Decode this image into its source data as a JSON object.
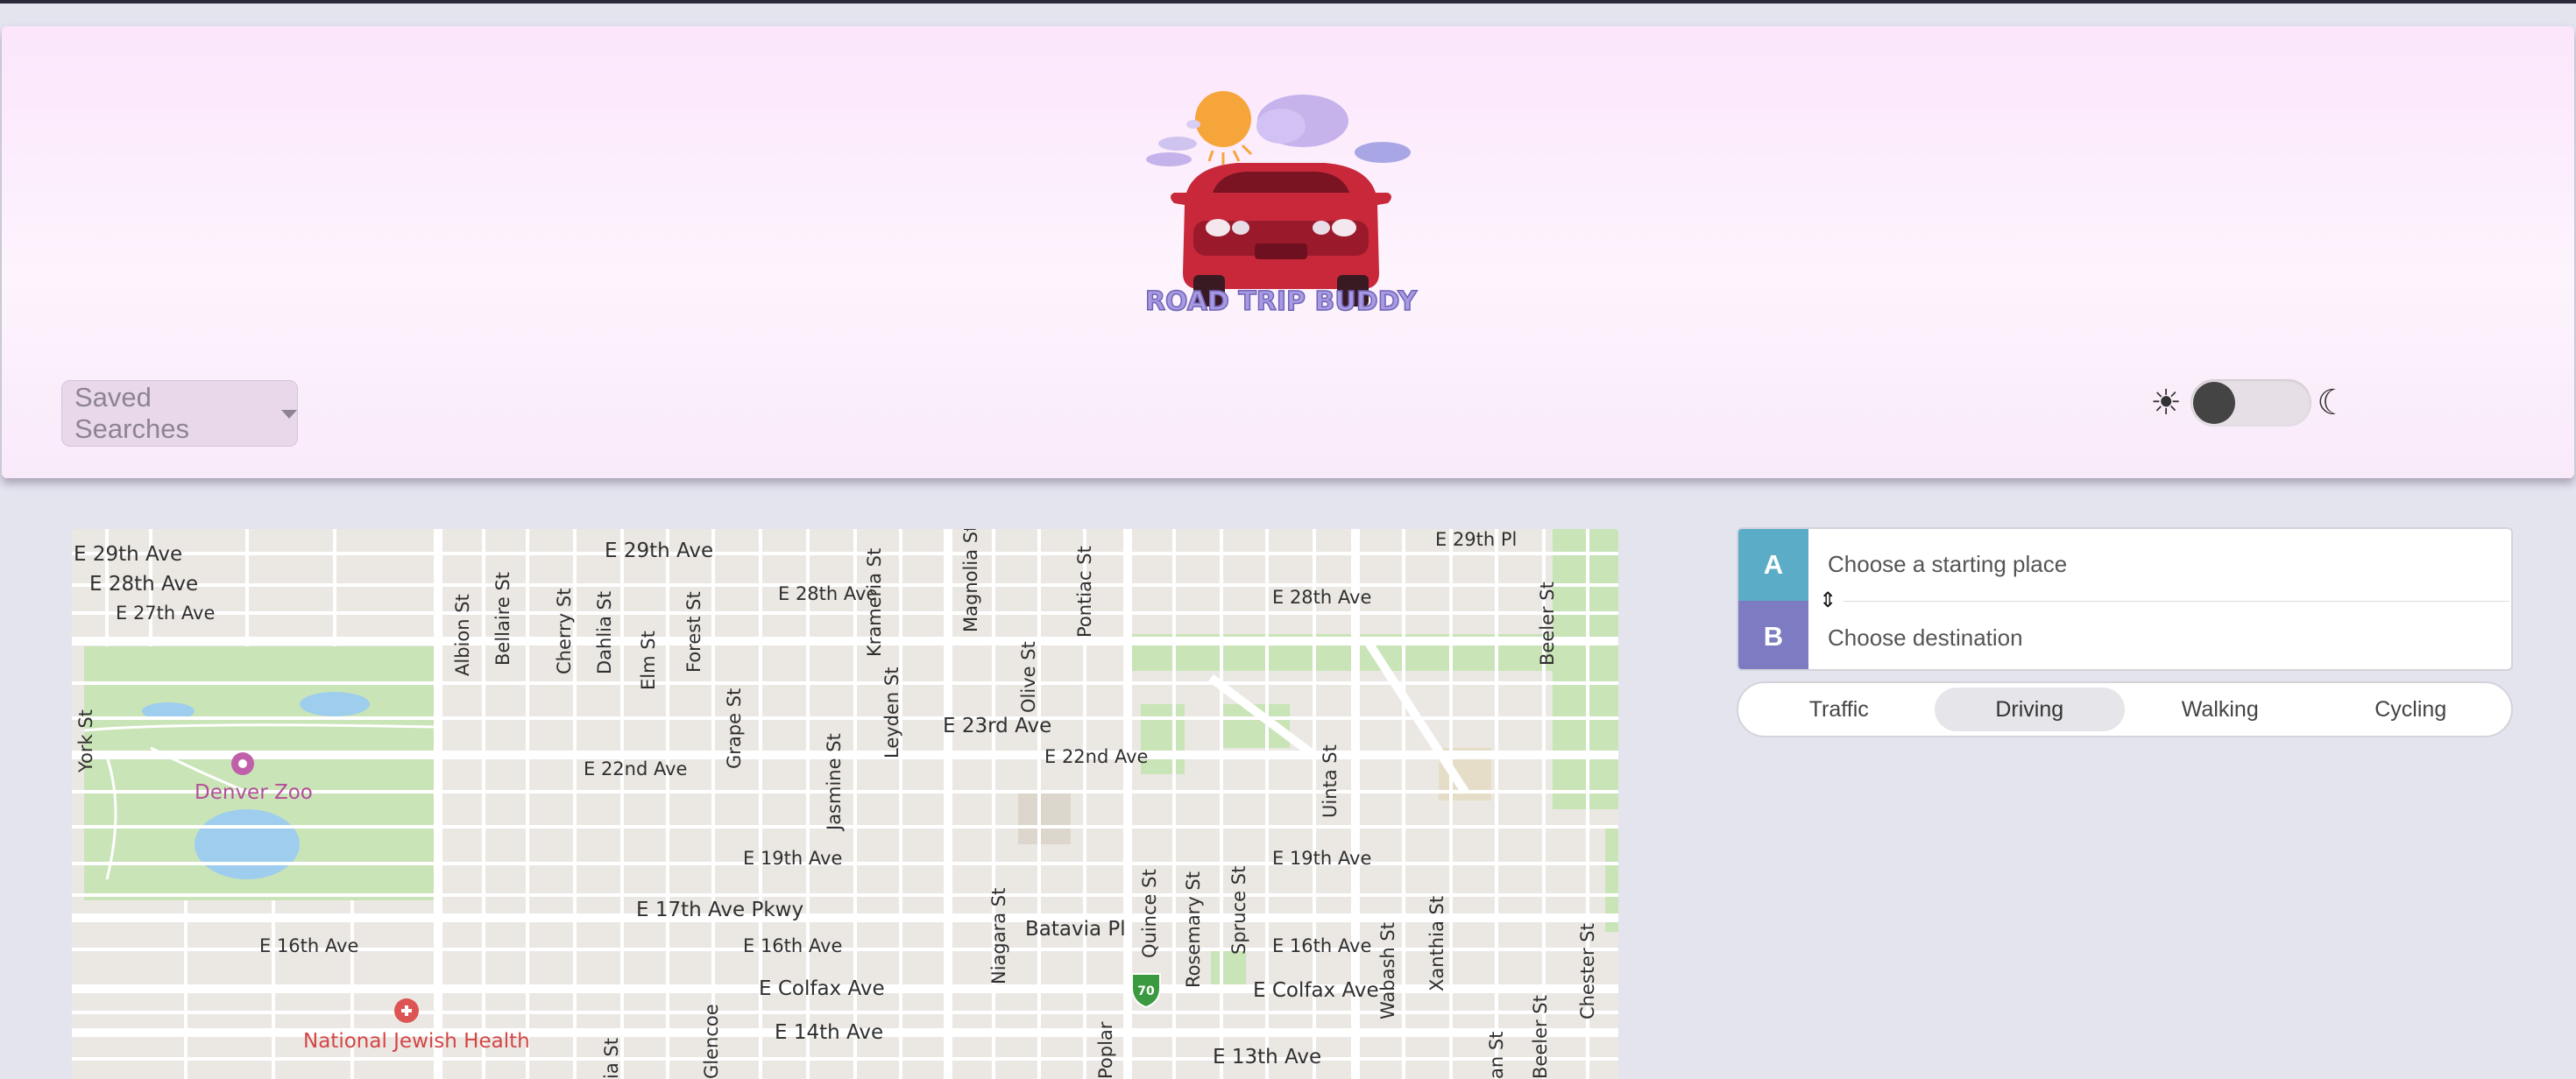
{
  "header": {
    "logo_text": "ROAD TRIP BUDDY",
    "saved_searches_label": "Saved Searches",
    "theme_light_symbol": "☀",
    "theme_dark_symbol": "☾"
  },
  "colors": {
    "header_bg": "#fbe6fb",
    "page_bg": "#e4e4ef",
    "pin_a": "#5bacc6",
    "pin_b": "#7d7bc2",
    "car": "#c8283a"
  },
  "route": {
    "start_label": "A",
    "destination_label": "B",
    "start_placeholder": "Choose a starting place",
    "destination_placeholder": "Choose destination",
    "swap_icon": "⇕"
  },
  "modes": {
    "items": [
      "Traffic",
      "Driving",
      "Walking",
      "Cycling"
    ],
    "selected": "Driving"
  },
  "map": {
    "streets": {
      "e29_ave_w": "E 29th Ave",
      "e28_ave_w": "E 28th Ave",
      "e27_ave_w": "E 27th Ave",
      "e29_ave": "E 29th Ave",
      "e28_ave": "E 28th Ave",
      "e29_pl": "E 29th Pl",
      "e28_ave_e": "E 28th Ave",
      "e23_ave": "E 23rd Ave",
      "e22_ave": "E 22nd Ave",
      "e22_ave_e": "E 22nd Ave",
      "e19_ave": "E 19th Ave",
      "e19_ave_e": "E 19th Ave",
      "e17_pkwy": "E 17th Ave Pkwy",
      "e16_ave_w": "E 16th Ave",
      "e16_ave": "E 16th Ave",
      "e16_ave_e": "E 16th Ave",
      "batavia": "Batavia Pl",
      "colfax": "E Colfax Ave",
      "colfax_e": "E Colfax Ave",
      "e14_ave": "E 14th Ave",
      "e13_ave": "E 13th Ave",
      "york": "York St",
      "albion": "Albion St",
      "bellaire": "Bellaire St",
      "cherry": "Cherry St",
      "dahlia": "Dahlia St",
      "elm": "Elm St",
      "forest": "Forest St",
      "grape": "Grape St",
      "jasmine": "Jasmine St",
      "leyden": "Leyden St",
      "krameria": "Krameria St",
      "magnolia": "Magnolia St",
      "olive": "Olive St",
      "pontiac": "Pontiac St",
      "niagara": "Niagara St",
      "quince": "Quince St",
      "rosemary": "Rosemary St",
      "spruce": "Spruce St",
      "uinta": "Uinta St",
      "wabash": "Wabash St",
      "xanthia": "Xanthia St",
      "beeler": "Beeler St",
      "beeler_s": "Beeler St",
      "chester": "Chester St",
      "glencoe": "Glencoe",
      "poplar": "Poplar",
      "ia_st": "ia St",
      "an_st": "an St"
    },
    "pois": {
      "zoo": "Denver Zoo",
      "hospital": "National Jewish Health",
      "interstate": "70"
    }
  }
}
